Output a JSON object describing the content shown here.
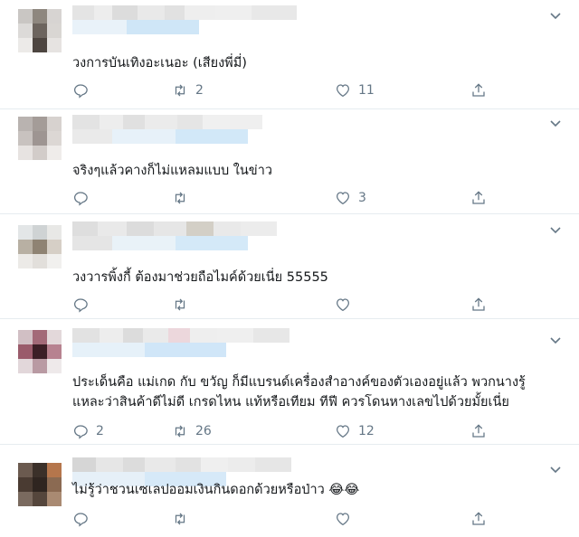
{
  "colors": {
    "text": "#14171a",
    "muted": "#657786",
    "divider": "#e6ecf0"
  },
  "tweets": [
    {
      "text": "วงการบันเทิงอะเนอะ (เสียงพี่มี่)",
      "replies": "",
      "retweets": "2",
      "likes": "11"
    },
    {
      "text": "จริงๆแล้วคางก็ไม่แหลมแบบ ในข่าว",
      "replies": "",
      "retweets": "",
      "likes": "3"
    },
    {
      "text": "วงวารพิ้งกี้ ต้องมาช่วยถือไมค์ด้วยเนี่ย 55555",
      "replies": "",
      "retweets": "",
      "likes": ""
    },
    {
      "text_line1": "ประเด็นคือ แม่เกด กับ ขวัญ ก็มีแบรนด์เครื่องสำอางค์ของตัวเองอยู่แล้ว พวกนางรู้",
      "text_line2": "แหละว่าสินค้าดีไม่ดี เกรดไหน แท้หรือเทียม ทีฟี ควรโดนหางเลขไปด้วยมั้ยเนี่ย",
      "replies": "2",
      "retweets": "26",
      "likes": "12"
    },
    {
      "text": "ไม่รู้ว่าชวนเซเลปออมเงินกินดอกด้วยหรือป่าว 😂😂",
      "replies": "",
      "retweets": "",
      "likes": ""
    }
  ],
  "icons": {
    "reply": "reply-icon",
    "retweet": "retweet-icon",
    "like": "heart-icon",
    "share": "share-icon",
    "more": "chevron-down-icon"
  }
}
